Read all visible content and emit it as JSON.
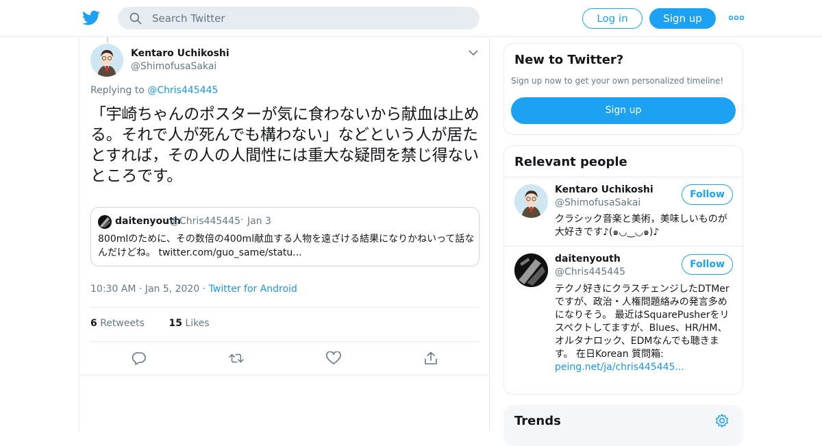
{
  "header": {
    "search_placeholder": "Search Twitter",
    "login_label": "Log in",
    "signup_label": "Sign up",
    "brand_color": "#1da1f2"
  },
  "tweet": {
    "author_name": "Kentaro Uchikoshi",
    "author_handle": "@ShimofusaSakai",
    "replying_prefix": "Replying to ",
    "replying_to": "@Chris445445",
    "text": "「宇崎ちゃんのポスターが気に食わないから献血は止める。それで人が死んでも構わない」などという人が居たとすれば，その人の人間性には重大な疑問を禁じ得ないところです。",
    "quote": {
      "author_name": "daitenyouth",
      "author_handle": "@Chris445445",
      "separator": "·",
      "date": "Jan 3",
      "text": "800mlのために、その数倍の400ml献血する人物を遠ざける結果になりかねいって話なんだけどね。 twitter.com/guo_same/statu..."
    },
    "time": "10:30 AM",
    "date": "Jan 5, 2020",
    "source": "Twitter for Android",
    "retweets_count": "6",
    "retweets_label": "Retweets",
    "likes_count": "15",
    "likes_label": "Likes"
  },
  "sidebar": {
    "new_to_twitter": {
      "title": "New to Twitter?",
      "subtitle": "Sign up now to get your own personalized timeline!",
      "button": "Sign up"
    },
    "relevant_people": {
      "title": "Relevant people",
      "people": [
        {
          "name": "Kentaro Uchikoshi",
          "handle": "@ShimofusaSakai",
          "follow": "Follow",
          "bio": "クラシック音楽と美術，美味しいものが大好きです♪(๑◡‿◡๑)♪",
          "bio_link": ""
        },
        {
          "name": "daitenyouth",
          "handle": "@Chris445445",
          "follow": "Follow",
          "bio": "テクノ好きにクラスチェンジしたDTMerですが、政治・人権問題絡みの発言多めになりそう。 最近はSquarePusherをリスペクトしてますが、Blues、HR/HM、オルタナロック、EDMなんでも聴きます。 在日Korean 質問箱: ",
          "bio_link": "peing.net/ja/chris445445..."
        }
      ]
    },
    "trends": {
      "title": "Trends"
    }
  }
}
